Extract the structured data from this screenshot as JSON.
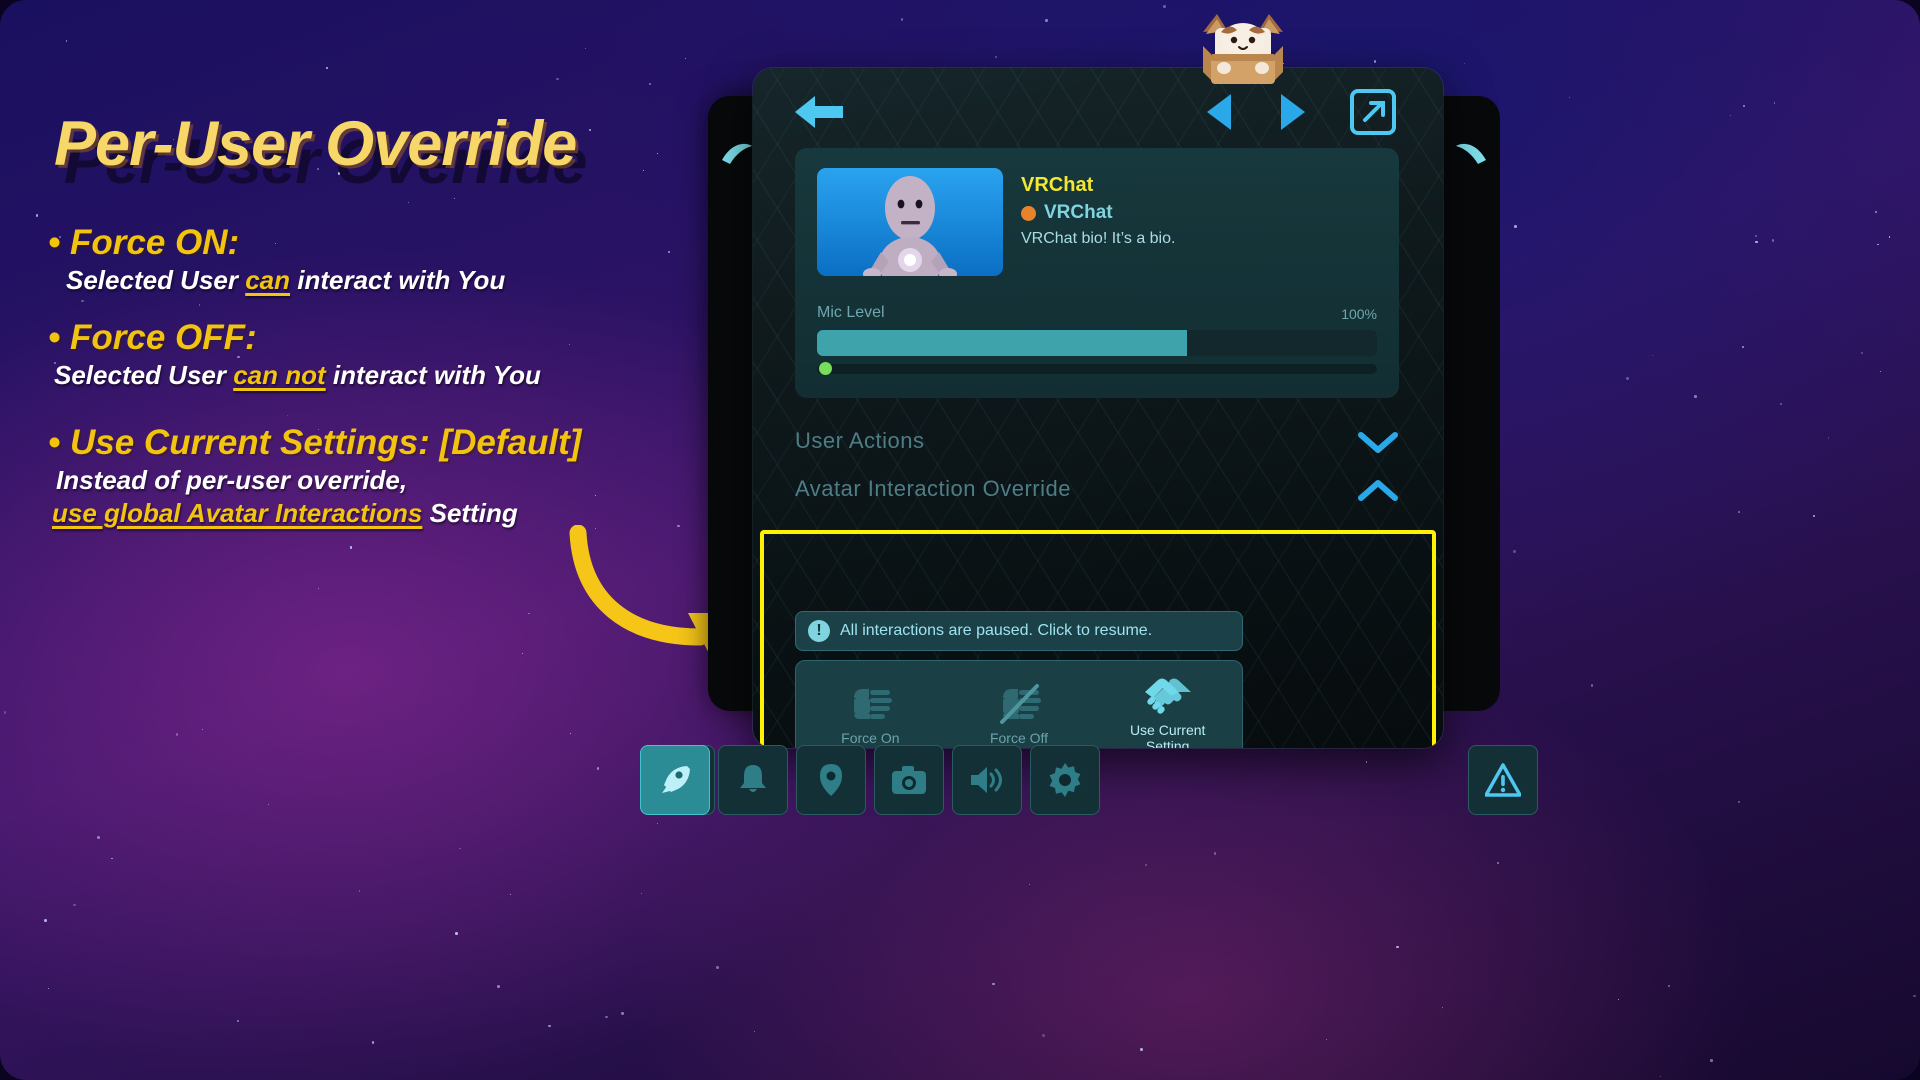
{
  "slide": {
    "title": "Per-User Override",
    "bullets": [
      {
        "head": "Force ON:",
        "sub_pre": "Selected User ",
        "sub_hl": "can",
        "sub_post": " interact with You"
      },
      {
        "head": "Force OFF:",
        "sub_pre": "Selected User ",
        "sub_hl": "can not",
        "sub_post": " interact with You"
      },
      {
        "head": "Use Current Settings: [Default]",
        "sub_line1": "Instead of per-user override,",
        "sub_line2_hl": "use global Avatar Interactions",
        "sub_line2_post": " Setting"
      }
    ],
    "bullet_marker": "•",
    "arrow_icon": "curved-arrow-icon"
  },
  "panel": {
    "nav": {
      "back_icon": "back-arrow-icon",
      "prev_icon": "prev-triangle-icon",
      "next_icon": "next-triangle-icon",
      "expand_icon": "expand-icon"
    },
    "mascot_icon": "cat-in-box-icon",
    "user": {
      "avatar_icon": "vrchat-robot-avatar",
      "display_name": "VRChat",
      "status_dot_color": "#e8832a",
      "status_name": "VRChat",
      "bio": "VRChat bio! It’s a bio."
    },
    "mic": {
      "label": "Mic Level",
      "value_label": "100%",
      "fill_percent": 66,
      "indicator_icon": "mic-activity-dot"
    },
    "sections": [
      {
        "title": "User Actions",
        "expanded": false,
        "chevron_icon": "chevron-down-icon"
      },
      {
        "title": "Avatar Interaction Override",
        "expanded": true,
        "chevron_icon": "chevron-up-icon"
      }
    ],
    "warning": {
      "icon": "exclamation-circle-icon",
      "text": "All interactions are paused. Click to resume."
    },
    "override_buttons": [
      {
        "label": "Force On",
        "icon": "open-hand-icon",
        "selected": false
      },
      {
        "label": "Force Off",
        "icon": "hand-slashed-icon",
        "selected": false
      },
      {
        "label": "Use Current\nSetting",
        "label_line1": "Use Current",
        "label_line2": "Setting",
        "icon": "handshake-icon",
        "selected": true
      }
    ],
    "highlight_color": "#fff200"
  },
  "toolbar": {
    "mute_button": {
      "icon": "mic-muted-icon",
      "active": false
    },
    "items": [
      {
        "icon": "rocket-icon",
        "active": true
      },
      {
        "icon": "bell-icon",
        "active": false
      },
      {
        "icon": "location-pin-icon",
        "active": false
      },
      {
        "icon": "camera-icon",
        "active": false
      },
      {
        "icon": "speaker-icon",
        "active": false
      },
      {
        "icon": "gear-icon",
        "active": false
      }
    ],
    "warn_button": {
      "icon": "warning-triangle-icon",
      "active": false
    }
  }
}
